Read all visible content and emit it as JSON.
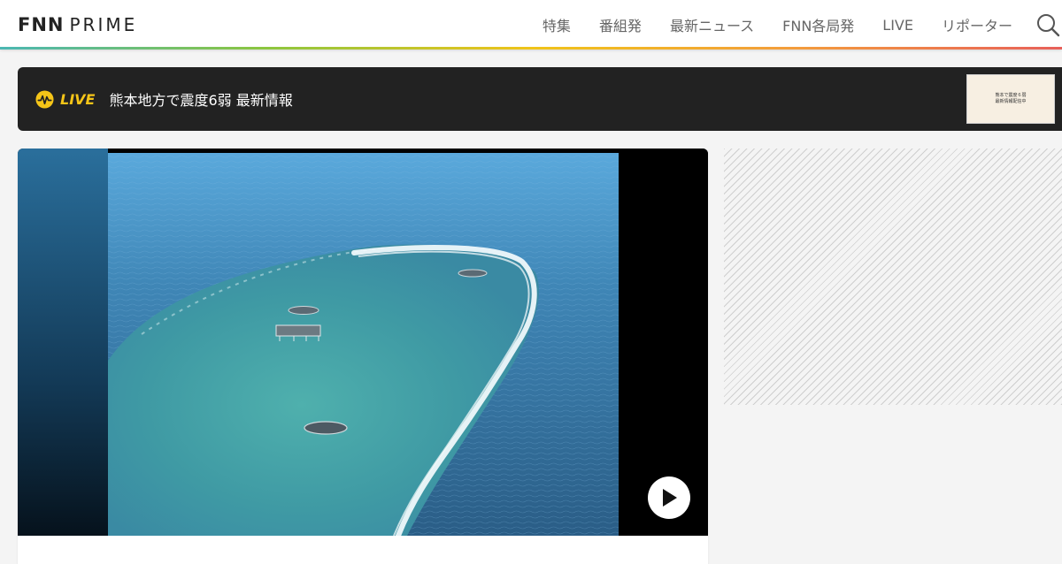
{
  "header": {
    "logo_primary": "FNN",
    "logo_secondary": "PRIME",
    "nav": [
      {
        "label": "特集"
      },
      {
        "label": "番組発"
      },
      {
        "label": "最新ニュース"
      },
      {
        "label": "FNN各局発"
      },
      {
        "label": "LIVE"
      },
      {
        "label": "リポーター"
      }
    ],
    "search_icon": "search-icon",
    "stripe_colors": [
      "#4bb7b3",
      "#8cc63f",
      "#f0c419",
      "#f39c3c",
      "#e8605a"
    ]
  },
  "live_banner": {
    "label": "LIVE",
    "title": "熊本地方で震度6弱 最新情報",
    "label_color": "#f5c518",
    "thumbnail_lines": [
      "熊本で震度６弱",
      "最新情報配信中"
    ]
  },
  "video": {
    "play_icon": "play-icon"
  },
  "colors": {
    "banner_background": "#222222",
    "page_background": "#f4f4f4"
  }
}
